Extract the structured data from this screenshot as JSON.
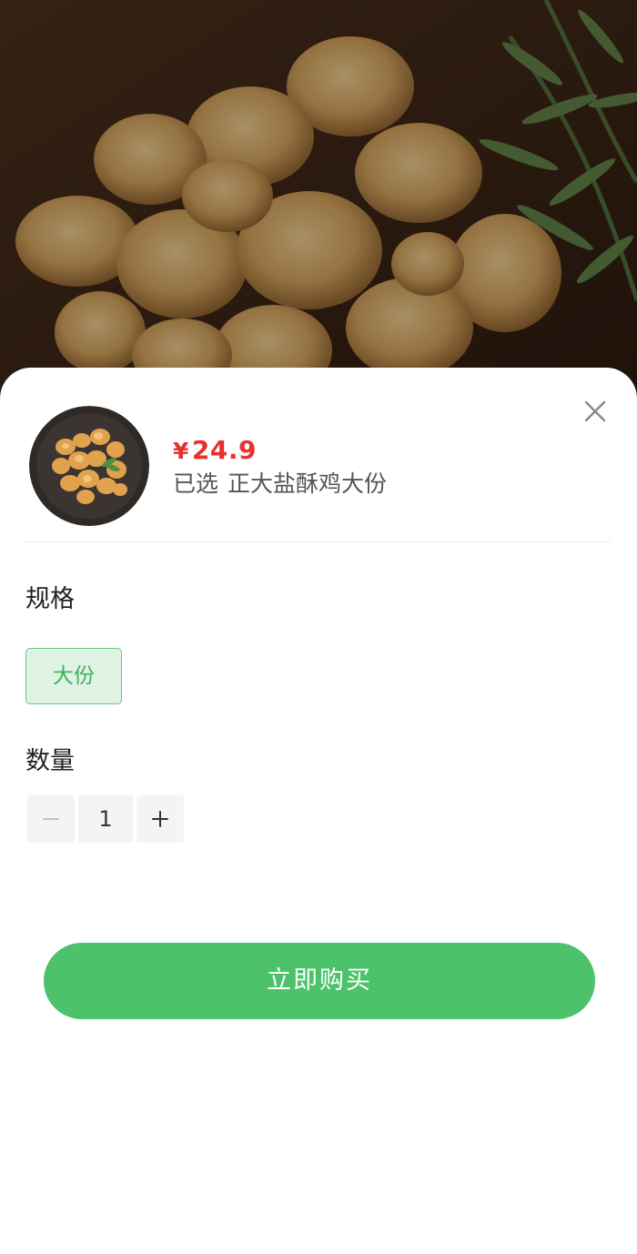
{
  "hero": {
    "image": "fried-salted-crispy-chicken-photo"
  },
  "sheet": {
    "close_icon": "close-icon",
    "thumbnail": "fried-chicken-plate-thumbnail",
    "price": {
      "currency": "¥",
      "amount": "24.9"
    },
    "selected": {
      "prefix": "已选",
      "value": "正大盐酥鸡大份"
    },
    "spec": {
      "title": "规格",
      "options": [
        "大份"
      ],
      "selected_option": "大份"
    },
    "quantity": {
      "title": "数量",
      "value": "1",
      "decrement_icon": "minus-icon",
      "increment_icon": "plus-icon"
    },
    "buy_button_label": "立即购买"
  },
  "colors": {
    "accent_green": "#4cc26a",
    "price_red": "#e8312b",
    "spec_selected_bg": "#dff2e4"
  }
}
